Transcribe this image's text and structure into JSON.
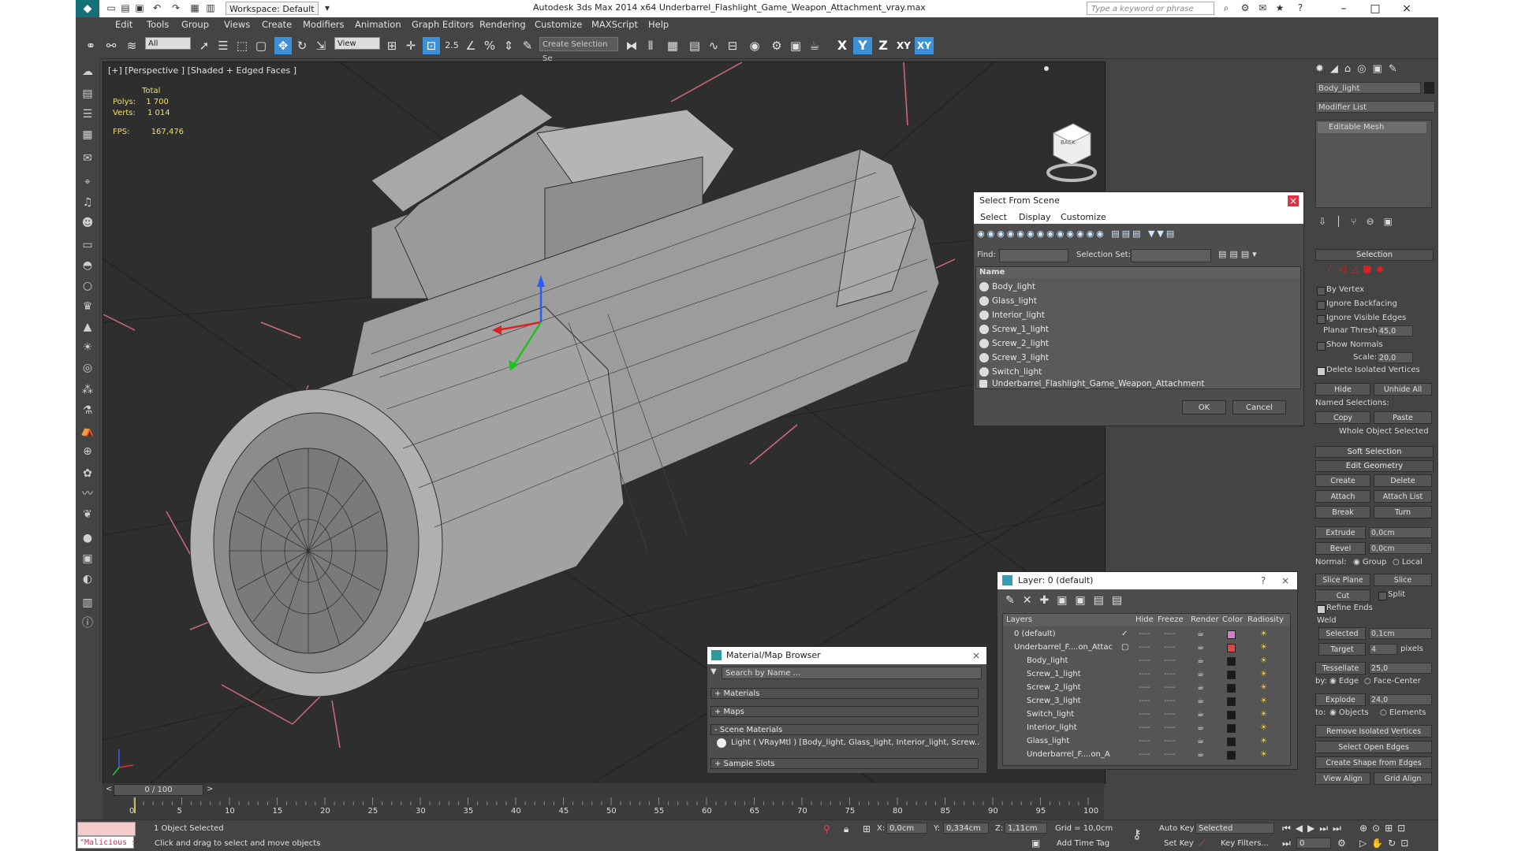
{
  "window": {
    "title": "Autodesk 3ds Max  2014 x64      Underbarrel_Flashlight_Game_Weapon_Attachment_vray.max",
    "workspace": "Workspace: Default",
    "search_placeholder": "Type a keyword or phrase",
    "minimize": "–",
    "maximize": "□",
    "close": "×"
  },
  "menu": [
    "Edit",
    "Tools",
    "Group",
    "Views",
    "Create",
    "Modifiers",
    "Animation",
    "Graph Editors",
    "Rendering",
    "Customize",
    "MAXScript",
    "Help"
  ],
  "toolbar": {
    "filter_value": "All",
    "ref_coord": "View",
    "selection_set": "Create Selection Se",
    "snap_label": "2.5",
    "axis_x": "X",
    "axis_y": "Y",
    "axis_z": "Z",
    "axis_xy": "XY",
    "axis_xy2": "XY"
  },
  "viewport": {
    "label": "[+] [Perspective ] [Shaded + Edged Faces ]",
    "stats": {
      "total": "Total",
      "polys_label": "Polys:",
      "polys": "1 700",
      "verts_label": "Verts:",
      "verts": "1 014",
      "fps_label": "FPS:",
      "fps": "167,476"
    },
    "viewcube_label": "BACK"
  },
  "select_from_scene": {
    "title": "Select From Scene",
    "tabs": [
      "Select",
      "Display",
      "Customize"
    ],
    "find_label": "Find:",
    "selection_set_label": "Selection Set:",
    "column_name": "Name",
    "items": [
      "Body_light",
      "Glass_light",
      "Interior_light",
      "Screw_1_light",
      "Screw_2_light",
      "Screw_3_light",
      "Switch_light",
      "Underbarrel_Flashlight_Game_Weapon_Attachment"
    ],
    "ok": "OK",
    "cancel": "Cancel"
  },
  "layer_panel": {
    "title": "Layer: 0 (default)",
    "help": "?",
    "columns": [
      "Layers",
      "Hide",
      "Freeze",
      "Render",
      "Color",
      "Radiosity"
    ],
    "rows": [
      {
        "name": "0 (default)",
        "color": "#d67ec9"
      },
      {
        "name": "Underbarrel_F....on_Attac",
        "color": "#d84848"
      },
      {
        "name": "Body_light",
        "color": "#1a1a1a"
      },
      {
        "name": "Screw_1_light",
        "color": "#1a1a1a"
      },
      {
        "name": "Screw_2_light",
        "color": "#1a1a1a"
      },
      {
        "name": "Screw_3_light",
        "color": "#1a1a1a"
      },
      {
        "name": "Switch_light",
        "color": "#1a1a1a"
      },
      {
        "name": "Interior_light",
        "color": "#1a1a1a"
      },
      {
        "name": "Glass_light",
        "color": "#1a1a1a"
      },
      {
        "name": "Underbarrel_F....on_A",
        "color": "#1a1a1a"
      }
    ],
    "hide_mark": "----",
    "freeze_mark": "----",
    "check": "✓"
  },
  "material_browser": {
    "title": "Material/Map Browser",
    "search": "Search by Name ...",
    "groups": [
      "+ Materials",
      "+ Maps",
      "- Scene Materials"
    ],
    "scene_material": "Light  ( VRayMtl ) [Body_light, Glass_light, Interior_light, Screw...",
    "sample_slots": "+ Sample Slots"
  },
  "command_panel": {
    "object_name": "Body_light",
    "modifier_list": "Modifier List",
    "stack_item": "Editable Mesh",
    "selection_rollout": "Selection",
    "by_vertex": "By Vertex",
    "ignore_backfacing": "Ignore Backfacing",
    "ignore_visible_edges": "Ignore Visible Edges",
    "planar_thresh": "Planar Thresh:",
    "planar_thresh_value": "45,0",
    "show_normals": "Show Normals",
    "scale_label": "Scale:",
    "scale_value": "20,0",
    "delete_isolated": "Delete Isolated Vertices",
    "hide": "Hide",
    "unhide_all": "Unhide All",
    "named_selections": "Named Selections:",
    "copy": "Copy",
    "paste": "Paste",
    "whole_object": "Whole Object Selected",
    "soft_selection": "Soft Selection",
    "edit_geometry": "Edit Geometry",
    "create": "Create",
    "delete": "Delete",
    "attach": "Attach",
    "attach_list": "Attach List",
    "break": "Break",
    "turn": "Turn",
    "extrude": "Extrude",
    "extrude_value": "0,0cm",
    "bevel": "Bevel",
    "bevel_value": "0,0cm",
    "normal_label": "Normal:",
    "group": "Group",
    "local": "Local",
    "slice_plane": "Slice Plane",
    "slice": "Slice",
    "cut": "Cut",
    "split": "Split",
    "refine_ends": "Refine Ends",
    "weld": "Weld",
    "selected": "Selected",
    "selected_value": "0,1cm",
    "target": "Target",
    "target_value": "4",
    "pixels": "pixels",
    "tessellate": "Tessellate",
    "tessellate_value": "25,0",
    "by_label": "by:",
    "edge": "Edge",
    "face_center": "Face-Center",
    "explode": "Explode",
    "explode_value": "24,0",
    "to_label": "to:",
    "objects": "Objects",
    "elements": "Elements",
    "remove_isolated": "Remove Isolated Vertices",
    "select_open_edges": "Select Open Edges",
    "create_shape": "Create Shape from Edges",
    "view_align": "View Align",
    "grid_align": "Grid Align"
  },
  "timeline": {
    "frame": "0 / 100",
    "ticks": [
      "0",
      "5",
      "10",
      "15",
      "20",
      "25",
      "30",
      "35",
      "40",
      "45",
      "50",
      "55",
      "60",
      "65",
      "70",
      "75",
      "80",
      "85",
      "90",
      "95",
      "100"
    ]
  },
  "status": {
    "maxscript": "\"Malicious s",
    "objects_selected": "1 Object Selected",
    "prompt": "Click and drag to select and move objects",
    "x_label": "X:",
    "x_value": "0,0cm",
    "y_label": "Y:",
    "y_value": "0,334cm",
    "z_label": "Z:",
    "z_value": "1,11cm",
    "grid": "Grid = 10,0cm",
    "add_time_tag": "Add Time Tag",
    "auto_key": "Auto Key",
    "selected": "Selected",
    "set_key": "Set Key",
    "key_filters": "Key Filters...",
    "frame_value": "0"
  },
  "colors": {
    "accent": "#3d8fd6",
    "background": "#444444",
    "viewport": "#2e2e2e",
    "stats_text": "#f0e060"
  }
}
